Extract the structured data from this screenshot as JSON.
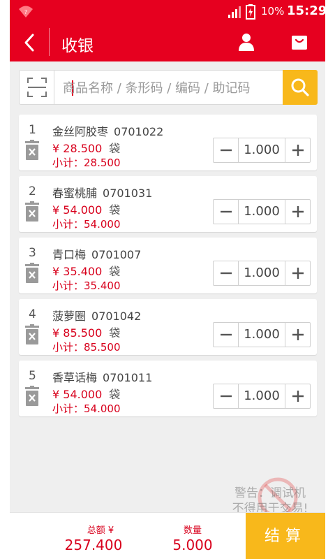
{
  "status_bar": {
    "battery": "10%",
    "time": "15:29"
  },
  "header": {
    "title": "收银",
    "back_icon": "chevron-left-icon",
    "user_icon": "user-icon",
    "bag_icon": "shopping-bag-icon"
  },
  "search": {
    "placeholder": "商品名称 / 条形码 / 编码 / 助记码",
    "value": ""
  },
  "items": [
    {
      "index": "1",
      "name": "金丝阿胶枣",
      "code": "0701022",
      "price": "¥  28.500",
      "unit": "袋",
      "subtotal": "小计：28.500",
      "qty": "1.000"
    },
    {
      "index": "2",
      "name": "春蜜桃脯",
      "code": "0701031",
      "price": "¥  54.000",
      "unit": "袋",
      "subtotal": "小计：54.000",
      "qty": "1.000"
    },
    {
      "index": "3",
      "name": "青口梅",
      "code": "0701007",
      "price": "¥  35.400",
      "unit": "袋",
      "subtotal": "小计：35.400",
      "qty": "1.000"
    },
    {
      "index": "4",
      "name": "菠萝圈",
      "code": "0701042",
      "price": "¥  85.500",
      "unit": "袋",
      "subtotal": "小计：85.500",
      "qty": "1.000"
    },
    {
      "index": "5",
      "name": "香草话梅",
      "code": "0701011",
      "price": "¥  54.000",
      "unit": "袋",
      "subtotal": "小计：54.000",
      "qty": "1.000"
    }
  ],
  "warning": {
    "line1": "警告：调试机",
    "line2": "不得用于交易!"
  },
  "footer": {
    "total_label": "总额 ¥",
    "total_value": "257.400",
    "qty_label": "数量",
    "qty_value": "5.000",
    "checkout_label": "结算"
  },
  "colors": {
    "brand_red": "#e6001f",
    "accent_yellow": "#f8b81b",
    "price_red": "#d8001c"
  }
}
